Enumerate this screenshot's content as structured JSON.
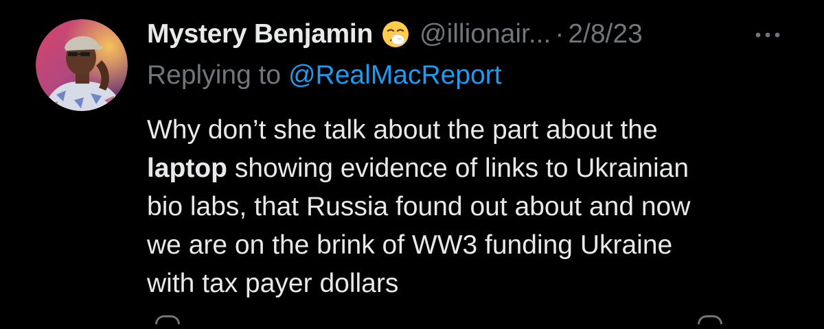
{
  "tweet": {
    "display_name": "Mystery Benjamin",
    "name_emoji": "sneezing-face-emoji",
    "handle": "@illionair...",
    "separator": "·",
    "date": "2/8/23",
    "reply_prefix": "Replying to",
    "reply_mention": "@RealMacReport",
    "body": {
      "line1": "Why don’t she talk about the part about the",
      "bold_word": "laptop",
      "line2_rest": " showing evidence of links to Ukrainian",
      "line3": "bio labs, that Russia found out about and now",
      "line4": "we are on the brink of WW3 funding Ukraine",
      "line5": "with tax payer dollars"
    }
  },
  "colors": {
    "background": "#000000",
    "primary_text": "#e7e9ea",
    "secondary_text": "#71767b",
    "link_blue": "#1d9bf0"
  },
  "icons": {
    "more": "more-dots-icon",
    "avatar": "profile-avatar"
  }
}
